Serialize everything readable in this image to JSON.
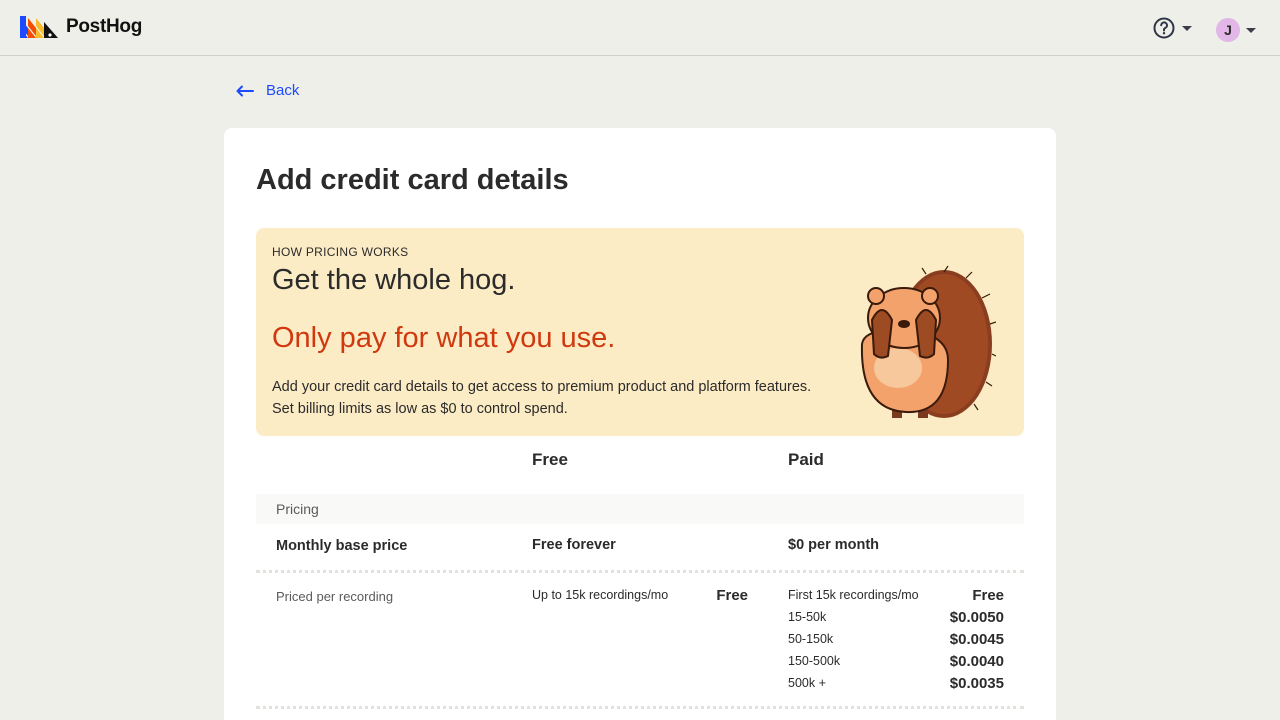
{
  "header": {
    "logo_text": "PostHog",
    "user_initial": "J",
    "help_icon": "help-circle-icon",
    "colors": {
      "accent": "#1d4aff",
      "avatar": "#e2b6e6"
    }
  },
  "back_link": {
    "label": "Back"
  },
  "page": {
    "title": "Add credit card details",
    "banner": {
      "eyebrow": "HOW PRICING WORKS",
      "headline": "Get the whole hog.",
      "subheadline": "Only pay for what you use.",
      "description": "Add your credit card details to get access to premium product and platform features. Set billing limits as low as $0 to control spend.",
      "colors": {
        "background": "#fcecc6",
        "subheadline": "#d0380e"
      }
    }
  },
  "table": {
    "columns": {
      "free": "Free",
      "paid": "Paid"
    },
    "section": "Pricing",
    "base_price": {
      "label": "Monthly base price",
      "free": "Free forever",
      "paid": "$0 per month"
    },
    "recording": {
      "label": "Priced per recording",
      "free_desc": "Up to 15k recordings/mo",
      "free_price": "Free",
      "tiers": [
        {
          "label": "First 15k recordings/mo",
          "price": "Free"
        },
        {
          "label": "15-50k",
          "price": "$0.0050"
        },
        {
          "label": "50-150k",
          "price": "$0.0045"
        },
        {
          "label": "150-500k",
          "price": "$0.0040"
        },
        {
          "label": "500k +",
          "price": "$0.0035"
        }
      ]
    }
  }
}
